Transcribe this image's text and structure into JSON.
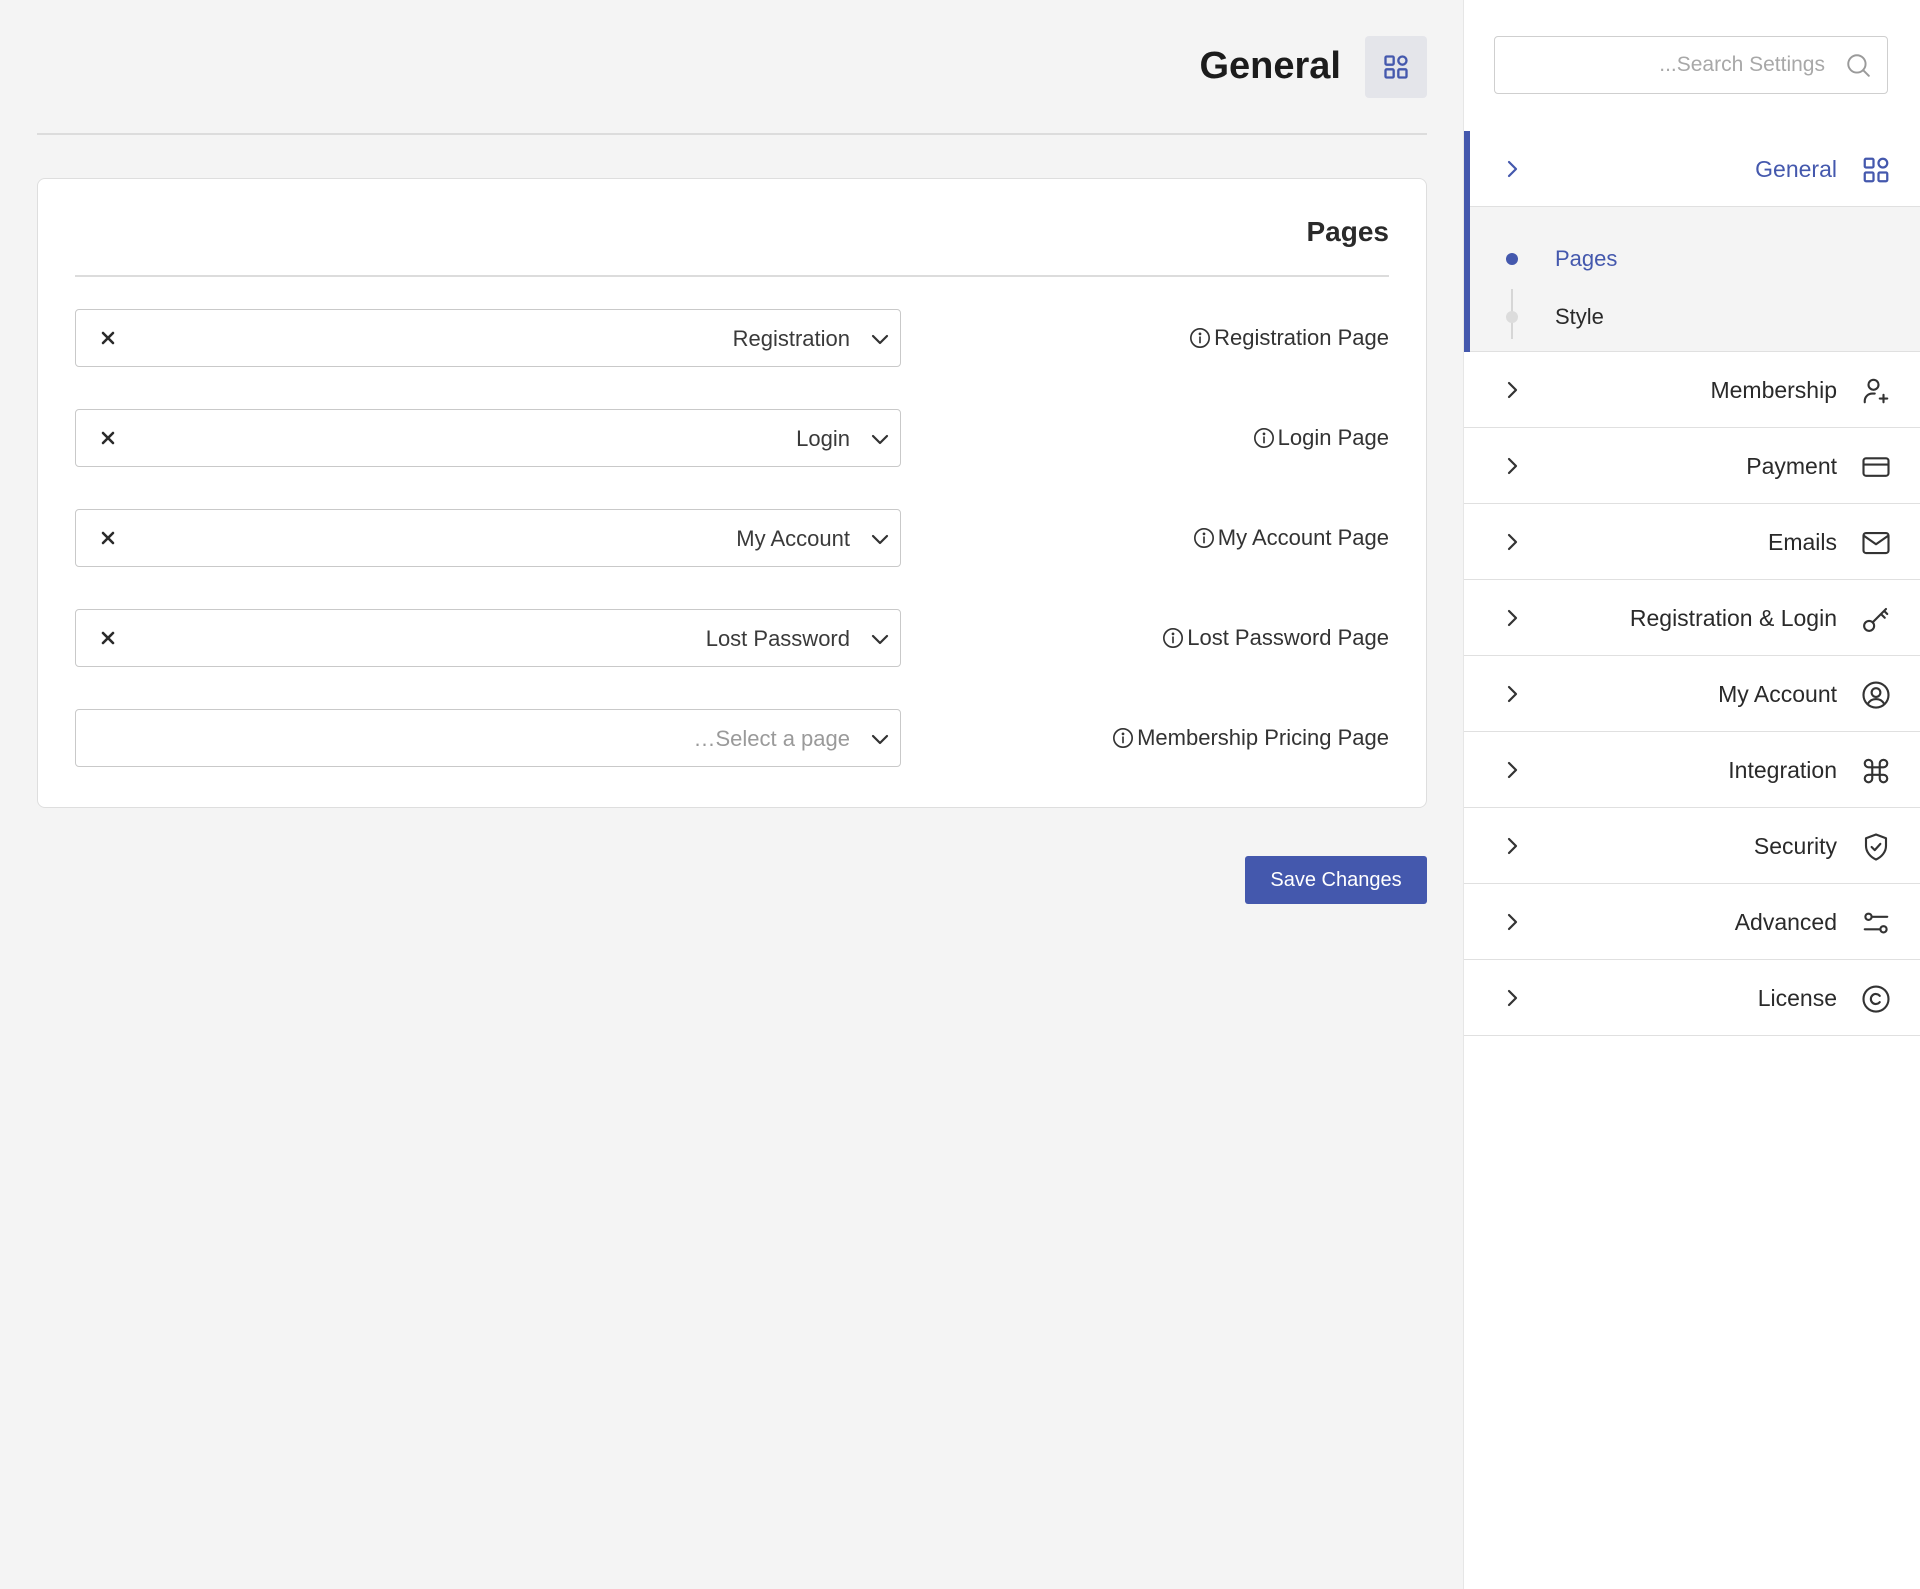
{
  "header": {
    "title": "General",
    "icon": "grid-icon"
  },
  "pages_card": {
    "title": "Pages",
    "rows": [
      {
        "value": "Registration",
        "label": "Registration Page",
        "clearable": true
      },
      {
        "value": "Login",
        "label": "Login Page",
        "clearable": true
      },
      {
        "value": "My Account",
        "label": "My Account Page",
        "clearable": true
      },
      {
        "value": "Lost Password",
        "label": "Lost Password Page",
        "clearable": true
      },
      {
        "value": "",
        "placeholder": "…Select a page",
        "label": "Membership Pricing Page",
        "clearable": false
      }
    ]
  },
  "actions": {
    "save_label": "Save Changes"
  },
  "sidebar": {
    "search": {
      "placeholder": "...Search Settings",
      "value": ""
    },
    "active_item": {
      "label": "General",
      "icon": "grid-icon",
      "subitems": [
        {
          "label": "Pages",
          "active": true
        },
        {
          "label": "Style",
          "active": false
        }
      ]
    },
    "items": [
      {
        "label": "Membership",
        "icon": "user-plus-icon"
      },
      {
        "label": "Payment",
        "icon": "credit-card-icon"
      },
      {
        "label": "Emails",
        "icon": "mail-icon"
      },
      {
        "label": "Registration & Login",
        "icon": "key-icon"
      },
      {
        "label": "My Account",
        "icon": "user-circle-icon"
      },
      {
        "label": "Integration",
        "icon": "command-icon"
      },
      {
        "label": "Security",
        "icon": "shield-check-icon"
      },
      {
        "label": "Advanced",
        "icon": "sliders-icon"
      },
      {
        "label": "License",
        "icon": "copyright-icon"
      }
    ]
  },
  "colors": {
    "accent": "#4458ad",
    "background": "#f4f4f4",
    "panel": "#ffffff",
    "inactive_dot": "#dcdcdc"
  }
}
